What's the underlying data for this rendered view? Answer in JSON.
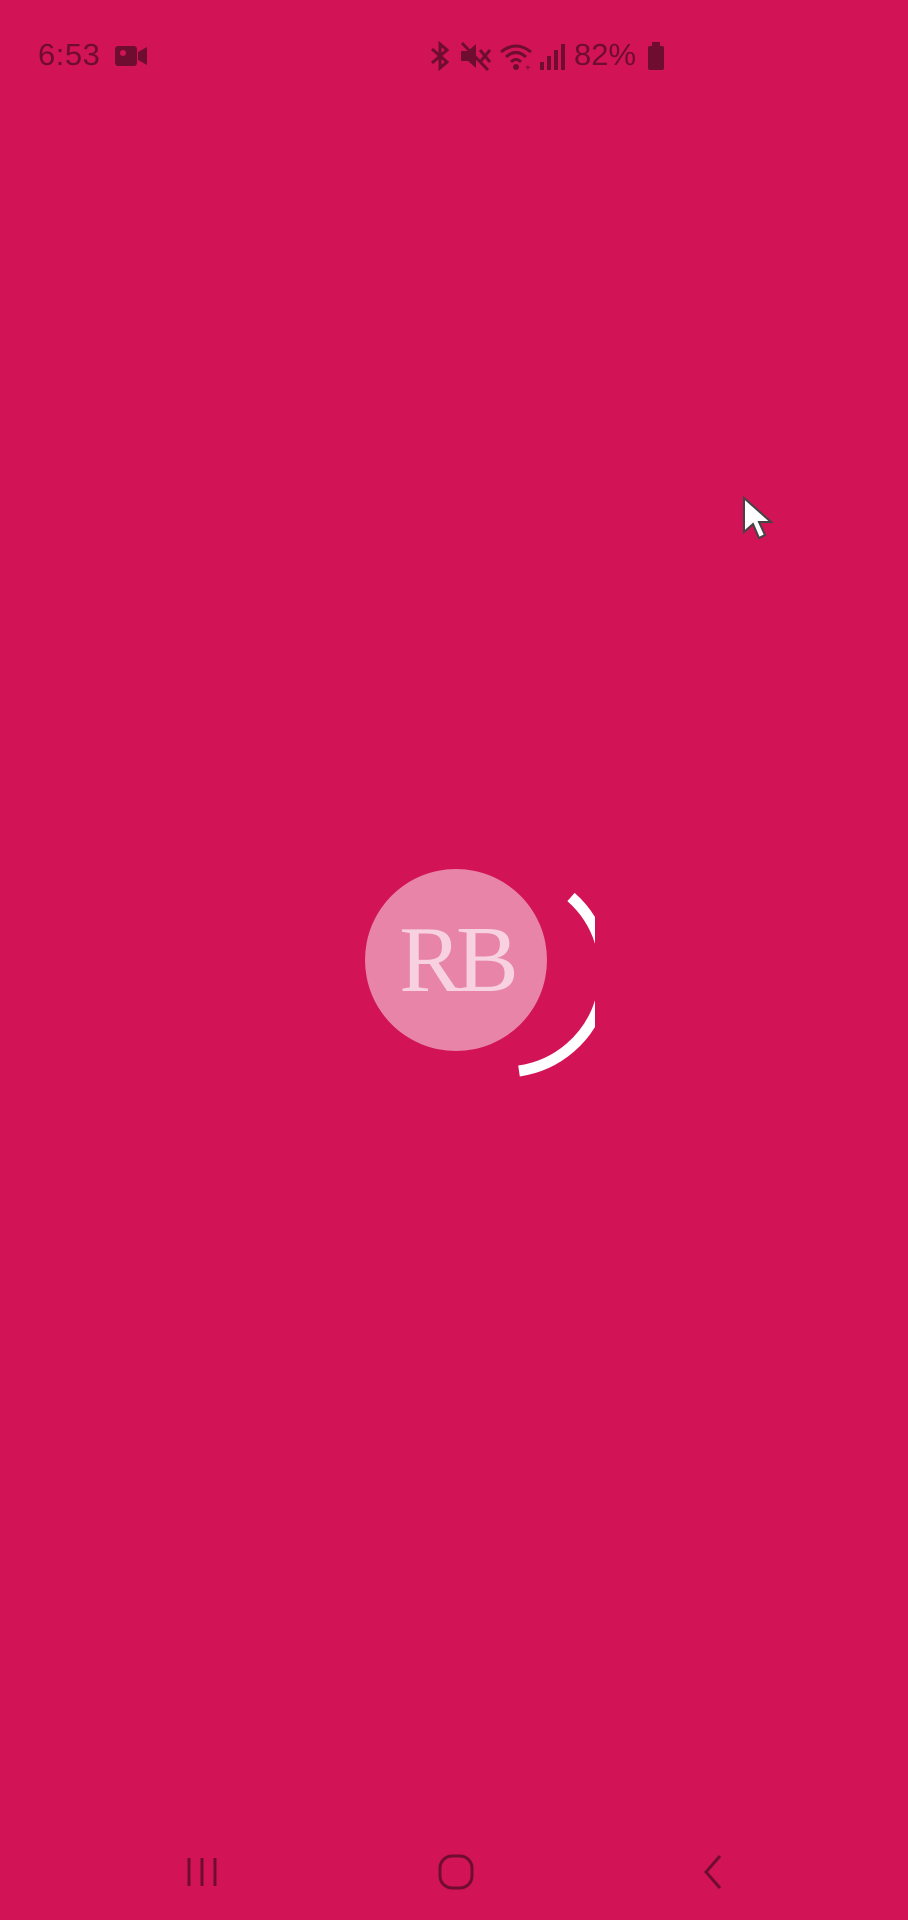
{
  "status_bar": {
    "time": "6:53",
    "battery_text": "82%",
    "icons": [
      "video-record-icon",
      "bluetooth-icon",
      "mute-icon",
      "wifi-icon",
      "signal-icon",
      "battery-icon"
    ]
  },
  "loader": {
    "logo_text": "RB"
  },
  "nav_bar": {
    "buttons": [
      "recent-apps-icon",
      "home-icon",
      "back-icon"
    ]
  },
  "colors": {
    "background": "#D21355",
    "logo_circle": "#E884A8",
    "status_text": "#6f0d31",
    "spinner": "#FFFFFF"
  }
}
